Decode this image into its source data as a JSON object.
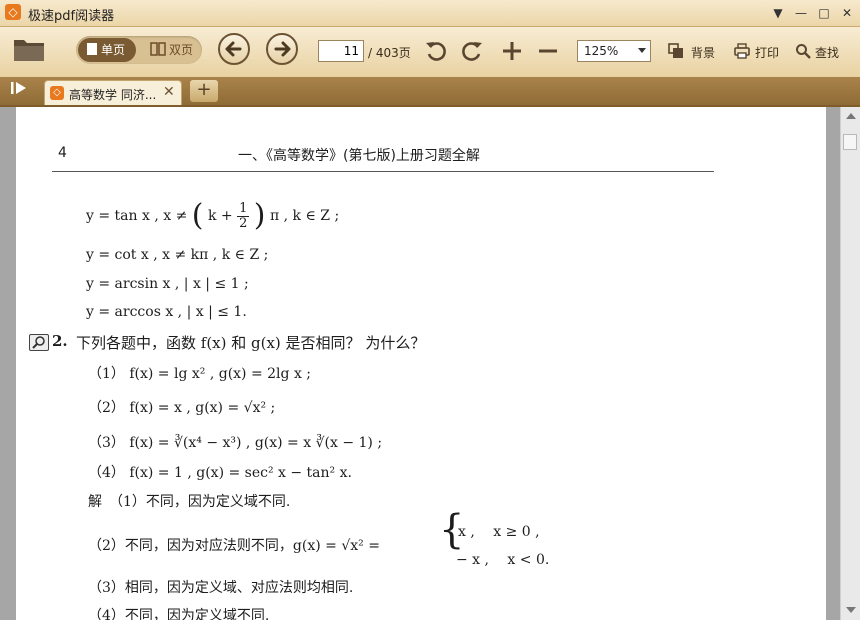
{
  "window": {
    "title": "极速pdf阅读器",
    "controls": [
      "▼",
      "—",
      "□",
      "✕"
    ]
  },
  "toolbar": {
    "single_page": "单页",
    "double_page": "双页",
    "current_page": "11",
    "total_pages": "/ 403页",
    "zoom": "125%",
    "background": "背景",
    "print": "打印",
    "find": "查找"
  },
  "tabs": [
    {
      "label": "高等数学 同济..."
    }
  ],
  "tabbar": {
    "new_tab": "+"
  },
  "document": {
    "page_number": "4",
    "header": "一、《高等数学》(第七版)上册习题全解",
    "lines": {
      "l1_a": "y = tan x , x ≠",
      "l1_k": "k +",
      "l1_num": "1",
      "l1_den": "2",
      "l1_b": "π , k ∈ Z ;",
      "l2": "y = cot x , x ≠ kπ , k ∈ Z ;",
      "l3": "y = arcsin x , | x | ≤ 1 ;",
      "l4": "y = arccos x , | x | ≤ 1.",
      "q_num": "2.",
      "q_text": "下列各题中，函数 f(x) 和 g(x) 是否相同？ 为什么？",
      "p1": "（1） f(x) = lg x² , g(x) = 2lg x ;",
      "p2": "（2） f(x) = x , g(x) = √x² ;",
      "p3": "（3） f(x) = ∛(x⁴ − x³) , g(x) = x ∛(x − 1) ;",
      "p4": "（4） f(x) = 1 , g(x) = sec² x − tan² x.",
      "a1": "解　（1）不同，因为定义域不同.",
      "a2": "（2）不同，因为对应法则不同，g(x) = √x² =",
      "a2_case1": "x ,　 x ≥ 0 ,",
      "a2_case2": "− x ,　 x < 0.",
      "a3": "（3）相同，因为定义域、对应法则均相同.",
      "a4": "（4）不同，因为定义域不同."
    }
  }
}
